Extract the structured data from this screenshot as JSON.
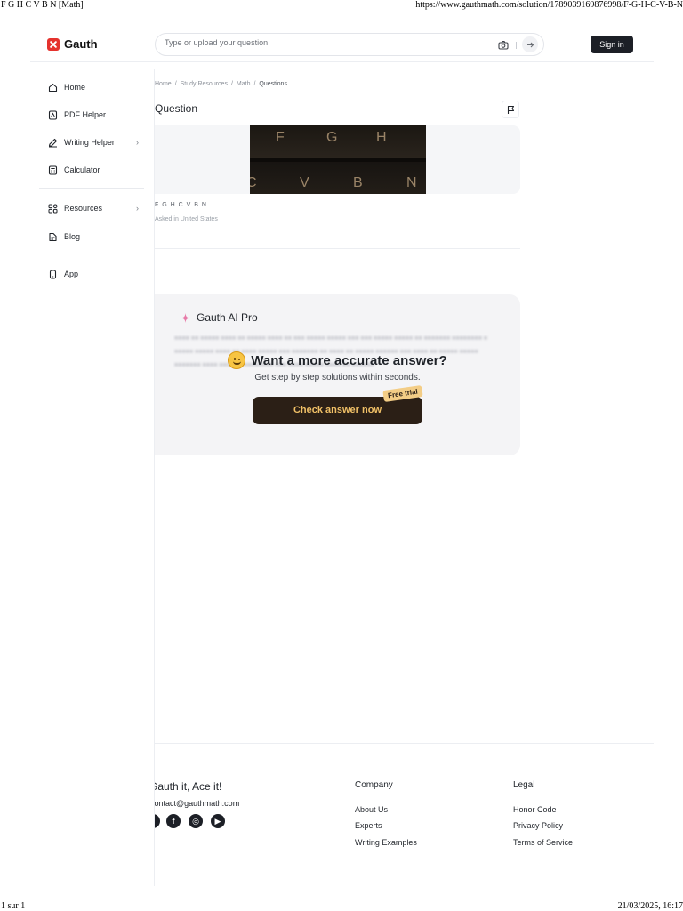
{
  "print": {
    "title": "F G H C V B N [Math]",
    "url": "https://www.gauthmath.com/solution/1789039169876998/F-G-H-C-V-B-N",
    "page": "1 sur 1",
    "datetime": "21/03/2025, 16:17"
  },
  "header": {
    "logo": "Gauth",
    "search_placeholder": "Type or upload your question",
    "signin": "Sign in"
  },
  "sidebar": {
    "items": [
      {
        "label": "Home",
        "icon": "home-icon"
      },
      {
        "label": "PDF Helper",
        "icon": "pdf-icon"
      },
      {
        "label": "Writing Helper",
        "icon": "pen-icon"
      },
      {
        "label": "Calculator",
        "icon": "calculator-icon"
      },
      {
        "label": "Resources",
        "icon": "grid-icon"
      },
      {
        "label": "Blog",
        "icon": "blog-icon"
      },
      {
        "label": "App",
        "icon": "phone-icon"
      }
    ]
  },
  "breadcrumb": [
    "Home",
    "Study Resources",
    "Math",
    "Questions"
  ],
  "question": {
    "title": "Question",
    "keys_top": [
      "F",
      "G",
      "H"
    ],
    "keys_bottom": [
      "C",
      "V",
      "B",
      "N"
    ],
    "text": "F G H C V B N",
    "meta": "Asked in United States"
  },
  "pro": {
    "title": "Gauth AI Pro",
    "cta_title": "Want a more accurate answer?",
    "cta_sub": "Get step by step solutions within seconds.",
    "button": "Check answer now",
    "tag": "Free trial"
  },
  "footer": {
    "brand": "Gauth it, Ace it!",
    "email": "contact@gauthmath.com",
    "socials": [
      "tiktok-icon",
      "facebook-icon",
      "instagram-icon",
      "youtube-icon"
    ],
    "company_title": "Company",
    "company_links": [
      "About Us",
      "Experts",
      "Writing Examples"
    ],
    "legal_title": "Legal",
    "legal_links": [
      "Honor Code",
      "Privacy Policy",
      "Terms of Service"
    ]
  }
}
